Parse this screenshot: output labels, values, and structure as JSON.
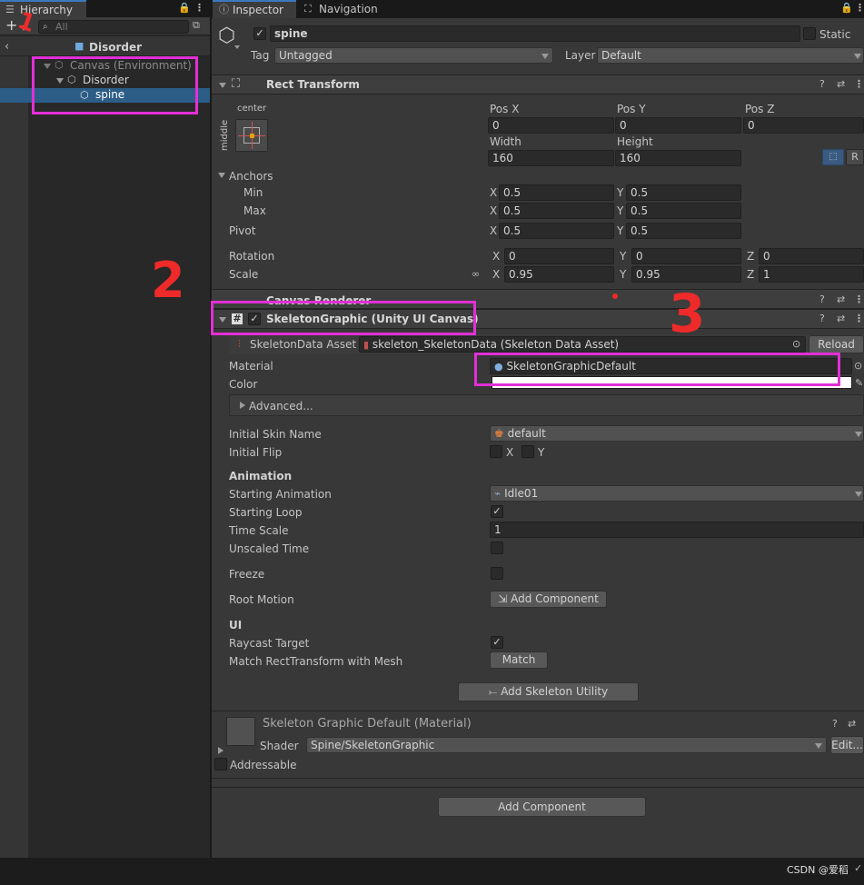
{
  "hierarchy": {
    "tab": "Hierarchy",
    "search_placeholder": "All",
    "scene": "Disorder",
    "items": [
      {
        "label": "Canvas (Environment)"
      },
      {
        "label": "Disorder"
      },
      {
        "label": "spine"
      }
    ]
  },
  "inspector": {
    "tabs": [
      "Inspector",
      "Navigation"
    ],
    "object": {
      "name": "spine",
      "static_label": "Static",
      "tag_label": "Tag",
      "tag_value": "Untagged",
      "layer_label": "Layer",
      "layer_value": "Default"
    },
    "rect_transform": {
      "title": "Rect Transform",
      "anchor_h": "center",
      "anchor_v": "middle",
      "pos_x_label": "Pos X",
      "pos_x": "0",
      "pos_y_label": "Pos Y",
      "pos_y": "0",
      "pos_z_label": "Pos Z",
      "pos_z": "0",
      "width_label": "Width",
      "width": "160",
      "height_label": "Height",
      "height": "160",
      "r_button": "R",
      "anchors_label": "Anchors",
      "min_label": "Min",
      "min_x": "0.5",
      "min_y": "0.5",
      "max_label": "Max",
      "max_x": "0.5",
      "max_y": "0.5",
      "pivot_label": "Pivot",
      "pivot_x": "0.5",
      "pivot_y": "0.5",
      "rotation_label": "Rotation",
      "rot_x": "0",
      "rot_y": "0",
      "rot_z": "0",
      "scale_label": "Scale",
      "scale_x": "0.95",
      "scale_y": "0.95",
      "scale_z": "1",
      "axis_x": "X",
      "axis_y": "Y",
      "axis_z": "Z"
    },
    "canvas_renderer": {
      "title": "Canvas Renderer"
    },
    "skeleton_graphic": {
      "title": "SkeletonGraphic (Unity UI Canvas)",
      "data_asset_label": "SkeletonData Asset",
      "data_asset_value": "skeleton_SkeletonData (Skeleton Data Asset)",
      "reload_button": "Reload",
      "material_label": "Material",
      "material_value": "SkeletonGraphicDefault",
      "color_label": "Color",
      "advanced_label": "Advanced...",
      "initial_skin_label": "Initial Skin Name",
      "initial_skin_value": "default",
      "initial_flip_label": "Initial Flip",
      "flip_x": "X",
      "flip_y": "Y",
      "animation_header": "Animation",
      "starting_anim_label": "Starting Animation",
      "starting_anim_value": "Idle01",
      "starting_loop_label": "Starting Loop",
      "time_scale_label": "Time Scale",
      "time_scale_value": "1",
      "unscaled_time_label": "Unscaled Time",
      "freeze_label": "Freeze",
      "root_motion_label": "Root Motion",
      "add_component_small": "Add Component",
      "ui_header": "UI",
      "raycast_label": "Raycast Target",
      "match_label": "Match RectTransform with Mesh",
      "match_button": "Match",
      "add_skeleton_utility": "Add Skeleton Utility"
    },
    "material": {
      "title": "Skeleton Graphic Default (Material)",
      "shader_label": "Shader",
      "shader_value": "Spine/SkeletonGraphic",
      "edit_button": "Edit...",
      "addressable_label": "Addressable"
    },
    "add_component_button": "Add Component"
  },
  "annotations": {
    "mark1": "1",
    "mark2": "2",
    "mark3": "3"
  },
  "footer": {
    "watermark": "CSDN @爱稻"
  },
  "colors": {
    "magenta": "#e22fd5",
    "selection": "#2c5d87",
    "red_mark": "#ee2a2a"
  }
}
